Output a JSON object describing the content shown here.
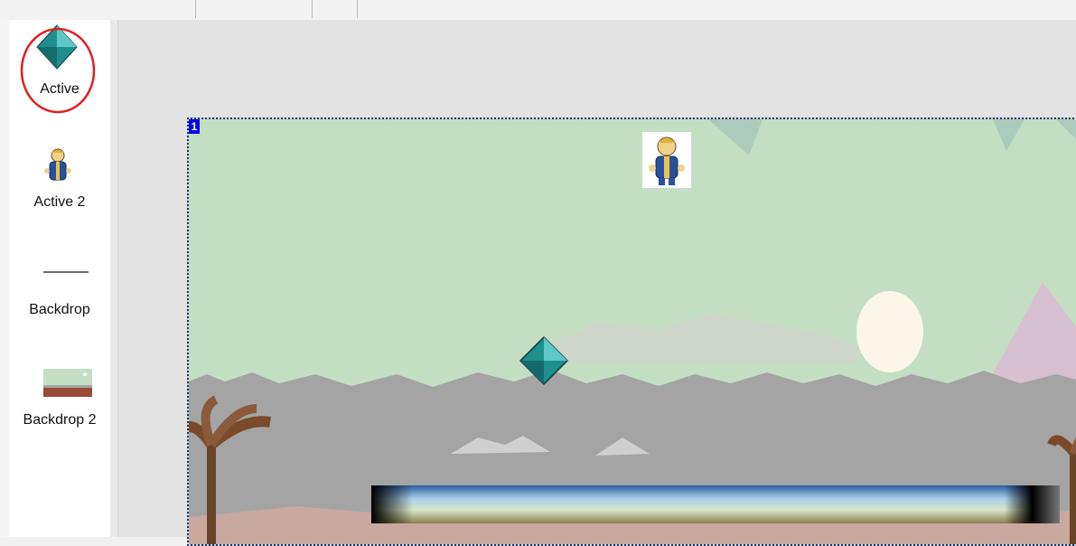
{
  "objects": [
    {
      "label": "Active",
      "icon": "diamond-icon",
      "selected": true
    },
    {
      "label": "Active 2",
      "icon": "vault-boy-icon"
    },
    {
      "label": "Backdrop",
      "icon": "line-backdrop-icon"
    },
    {
      "label": "Backdrop 2",
      "icon": "landscape-backdrop-icon"
    }
  ],
  "frame": {
    "number": "1"
  },
  "colors": {
    "sky": "#c4dec4",
    "ground": "#a4a4a4",
    "diamond": "#1f8e8e",
    "frame_border": "#2b2b6e",
    "frame_number_bg": "#0000ee",
    "selection_circle": "#e02020"
  }
}
